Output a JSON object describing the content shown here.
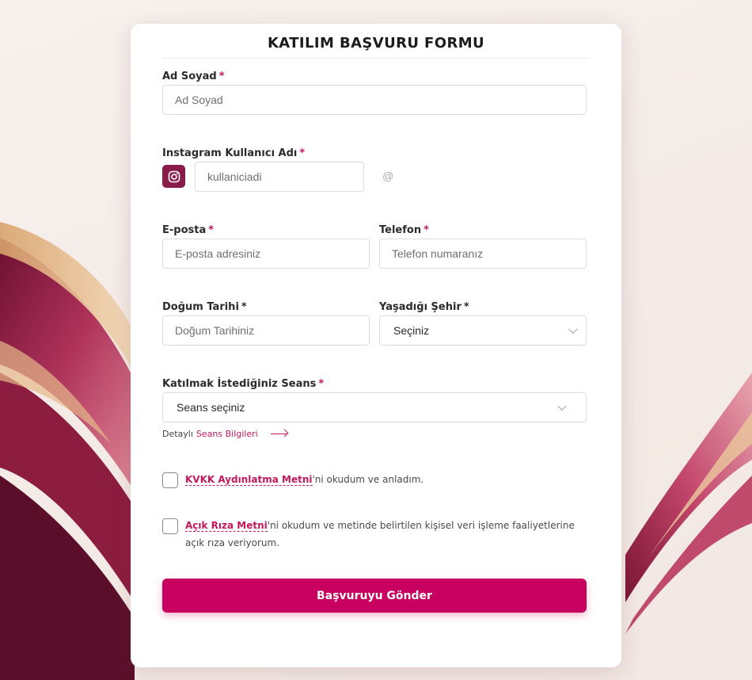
{
  "form": {
    "title": "KATILIM BAŞVURU FORMU",
    "required_mark": "*",
    "fields": {
      "name": {
        "label": "Ad Soyad",
        "placeholder": "Ad Soyad"
      },
      "instagram": {
        "label": "Instagram Kullanıcı Adı",
        "placeholder": "kullaniciadi",
        "suffix": "@",
        "icon": "instagram-icon"
      },
      "email": {
        "label": "E-posta",
        "placeholder": "E-posta adresiniz"
      },
      "phone": {
        "label": "Telefon",
        "placeholder": "Telefon numaranız"
      },
      "birthdate": {
        "label": "Doğum Tarihi",
        "placeholder": "Doğum Tarihiniz"
      },
      "city": {
        "label": "Yaşadığı Şehir",
        "value": "Seçiniz"
      },
      "session": {
        "label": "Katılmak İstediğiniz Seans",
        "value": "Seans seçiniz"
      }
    },
    "session_details": {
      "prefix": "Detaylı",
      "link": "Seans Bilgileri"
    },
    "consents": [
      {
        "link": "KVKK Aydınlatma Metni",
        "text": "'ni okudum ve anladım."
      },
      {
        "link": "Açık Rıza Metni",
        "text": "'ni okudum ve metinde belirtilen kişisel veri işleme faaliyetlerine açık rıza veriyorum."
      }
    ],
    "submit_label": "Başvuruyu Gönder"
  },
  "colors": {
    "accent": "#c8005f",
    "instagram_button": "#8a1c4a",
    "required": "#c2185b"
  }
}
